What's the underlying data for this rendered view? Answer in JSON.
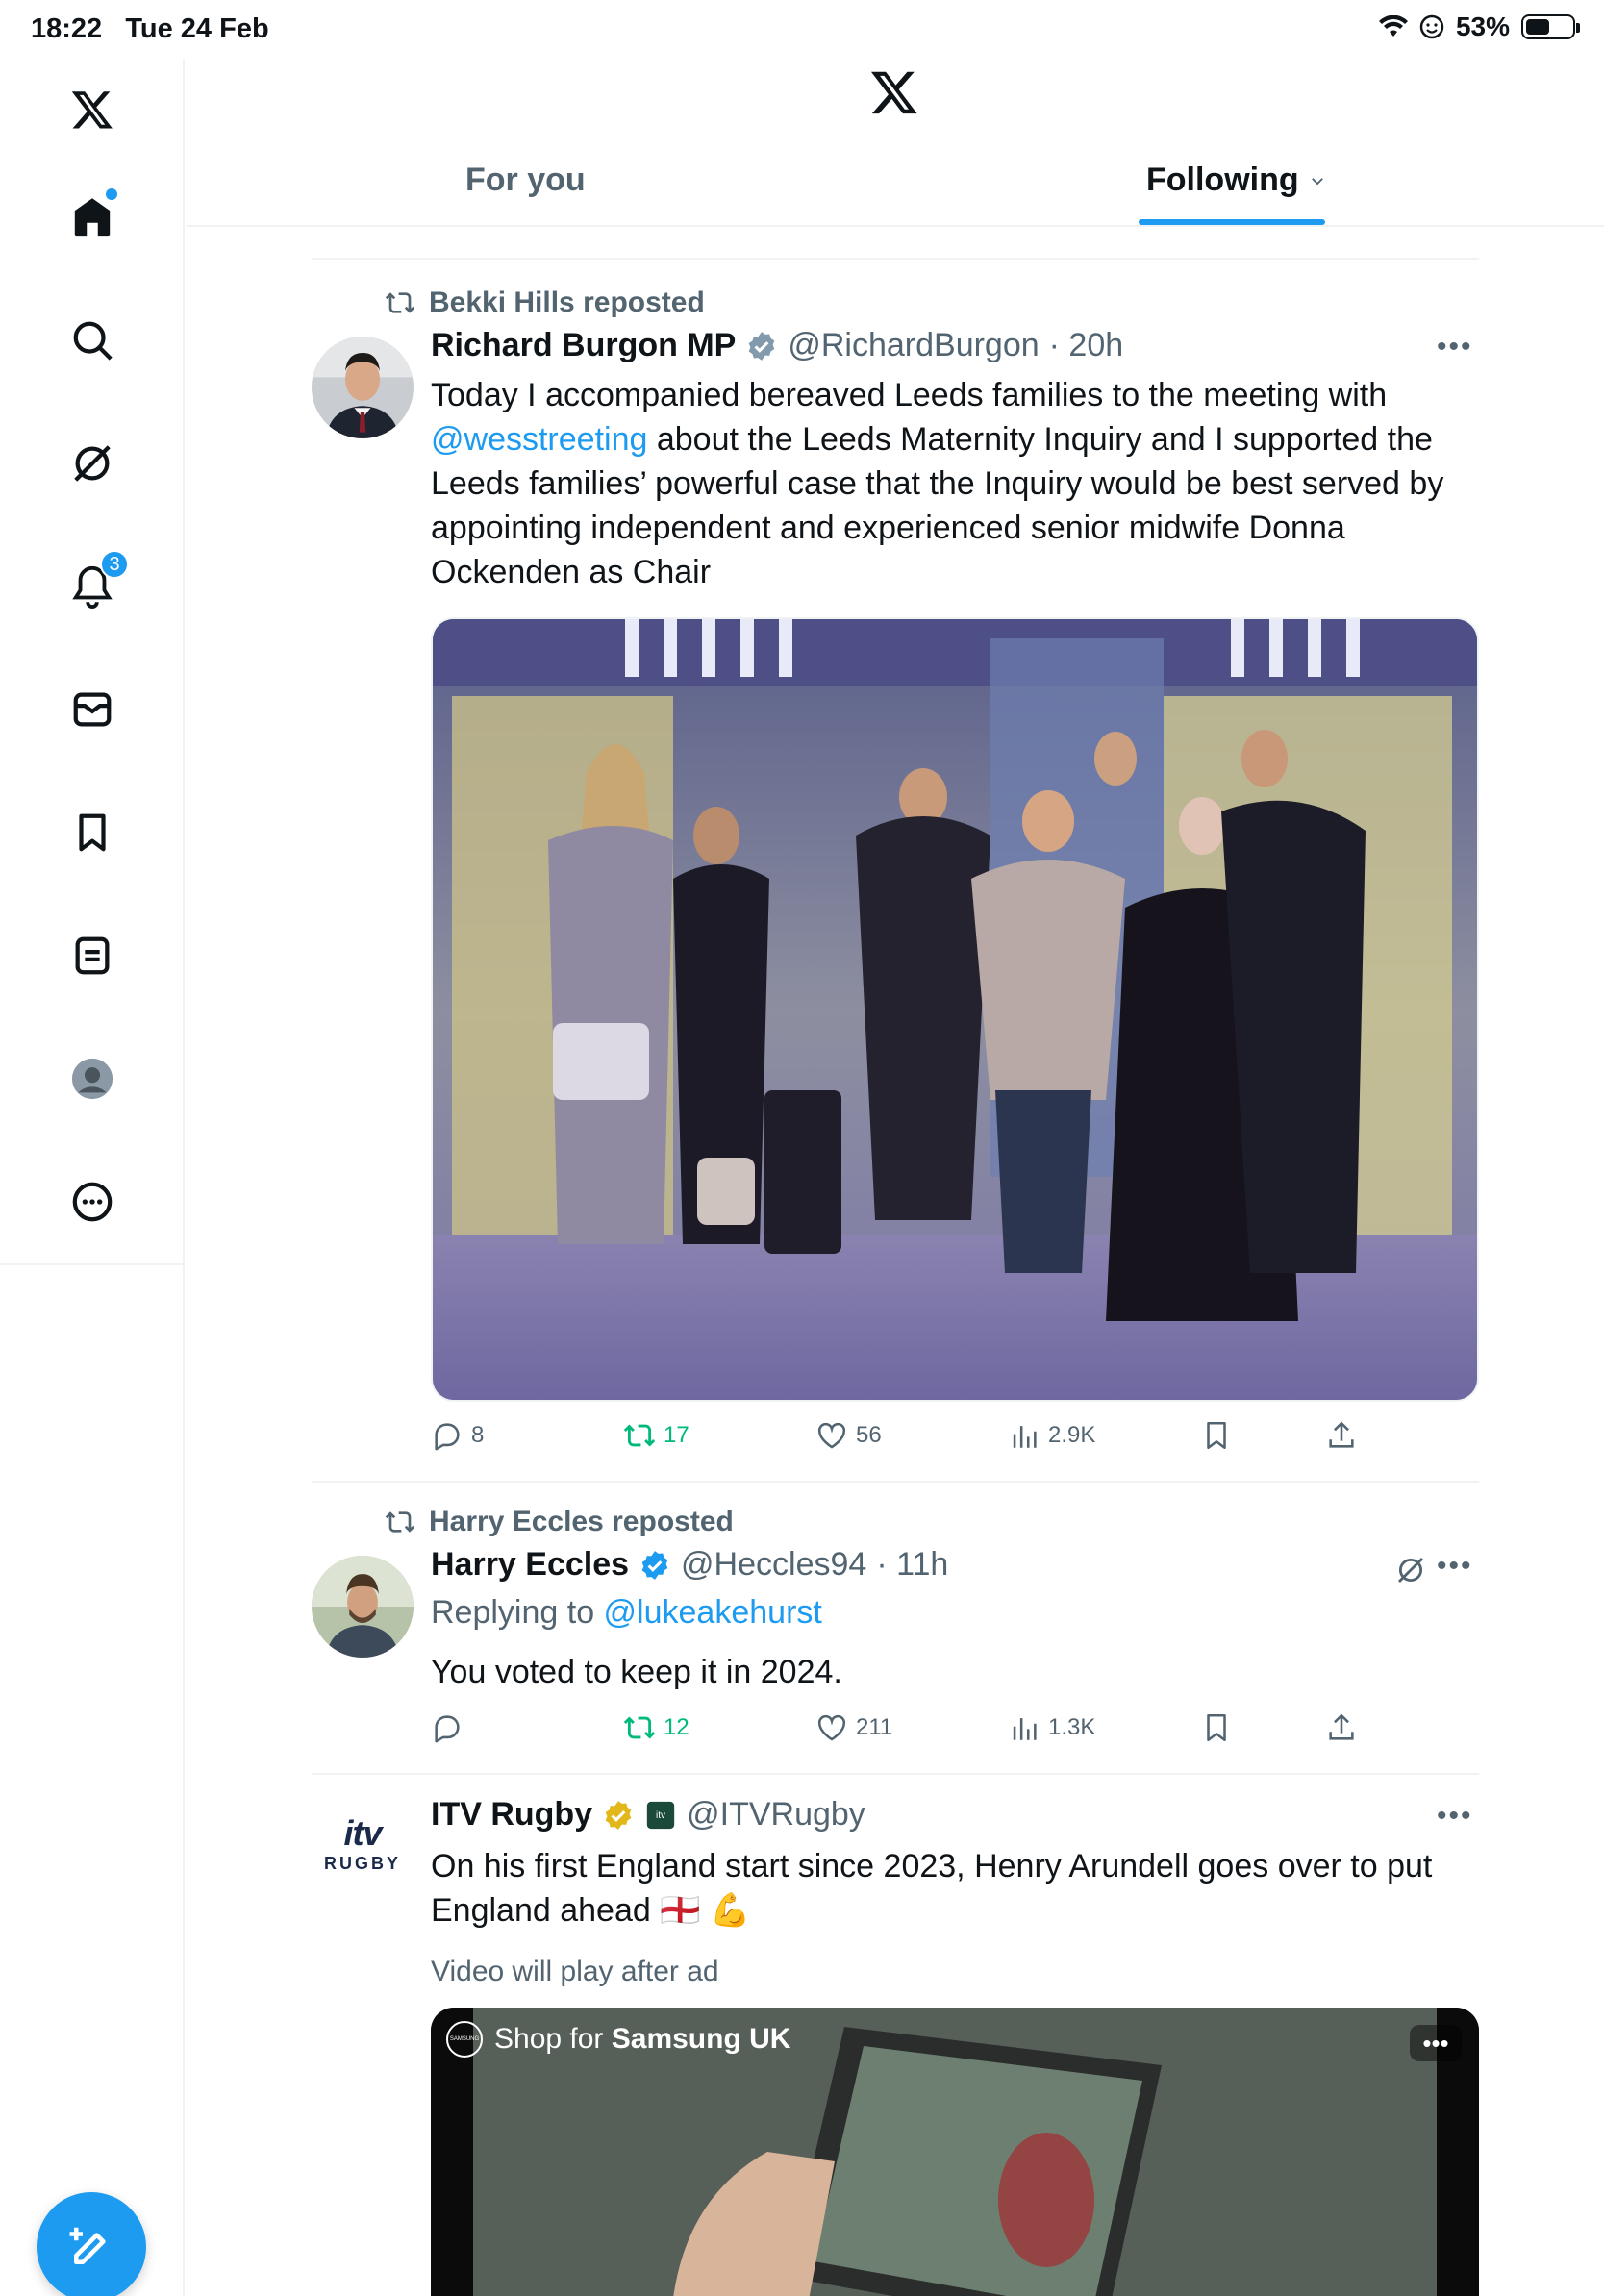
{
  "status_bar": {
    "time": "18:22",
    "date": "Tue 24 Feb",
    "battery": "53%",
    "battery_level": 0.53
  },
  "nav": {
    "notifications_badge": "3",
    "items": [
      "home-icon",
      "search-icon",
      "grok-icon",
      "notifications-icon",
      "messages-icon",
      "bookmarks-icon",
      "lists-icon",
      "profile-icon",
      "more-icon"
    ]
  },
  "header": {
    "tabs": [
      {
        "label": "For you",
        "active": false
      },
      {
        "label": "Following",
        "active": true
      }
    ]
  },
  "colors": {
    "accent": "#1d9bf0",
    "secondary_text": "#536471",
    "repost_green": "#00ba7c",
    "divider": "#eff3f4"
  },
  "tweets": [
    {
      "reposted_by": "Bekki Hills reposted",
      "name": "Richard Burgon MP",
      "handle": "@RichardBurgon",
      "time": "· 20h",
      "text_before": "Today I accompanied bereaved Leeds families to the meeting with ",
      "mention": "@wesstreeting",
      "text_after": " about the Leeds Maternity Inquiry and I supported the Leeds families’ powerful case that the Inquiry would be best served by appointing independent and experienced senior midwife Donna Ockenden as Chair",
      "replies": "8",
      "reposts": "17",
      "likes": "56",
      "views": "2.9K"
    },
    {
      "reposted_by": "Harry Eccles reposted",
      "name": "Harry Eccles",
      "handle": "@Heccles94",
      "time": "· 11h",
      "replying_label": "Replying to ",
      "replying_to": "@lukeakehurst",
      "text": "You voted to keep it in 2024.",
      "replies": "",
      "reposts": "12",
      "likes": "211",
      "views": "1.3K"
    },
    {
      "name": "ITV Rugby",
      "handle": "@ITVRugby",
      "logo_top": "itv",
      "logo_bottom": "RUGBY",
      "text": "On his first England start since 2023, Henry Arundell goes over to put England ahead 🏴󠁧󠁢󠁥󠁮󠁧󠁿 💪",
      "ad_label": "Video will play after ad",
      "ad_shop_prefix": "Shop for ",
      "ad_brand": "Samsung UK",
      "ad_logo_text": "SAMSUNG"
    }
  ]
}
